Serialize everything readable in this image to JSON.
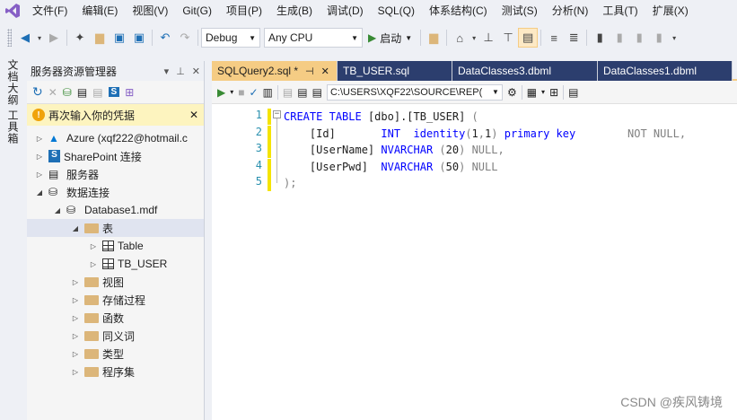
{
  "menubar": {
    "items": [
      "文件(F)",
      "编辑(E)",
      "视图(V)",
      "Git(G)",
      "项目(P)",
      "生成(B)",
      "调试(D)",
      "SQL(Q)",
      "体系结构(C)",
      "测试(S)",
      "分析(N)",
      "工具(T)",
      "扩展(X)"
    ]
  },
  "toolbar": {
    "config": "Debug",
    "platform": "Any CPU",
    "run_label": "启动"
  },
  "left_strip": {
    "tabs": [
      "文档大纲",
      "工具箱"
    ]
  },
  "explorer": {
    "title": "服务器资源管理器",
    "warning": "再次输入你的凭据",
    "tree": [
      {
        "label": "Azure (xqf222@hotmail.c",
        "icon": "azure-icon",
        "level": 0,
        "expanded": false
      },
      {
        "label": "SharePoint 连接",
        "icon": "sharepoint-icon",
        "level": 0,
        "expanded": false
      },
      {
        "label": "服务器",
        "icon": "server-icon",
        "level": 0,
        "expanded": false
      },
      {
        "label": "数据连接",
        "icon": "data-connections-icon",
        "level": 0,
        "expanded": true
      },
      {
        "label": "Database1.mdf",
        "icon": "database-icon",
        "level": 1,
        "expanded": true
      },
      {
        "label": "表",
        "icon": "folder-icon",
        "level": 2,
        "expanded": true,
        "selected": true
      },
      {
        "label": "Table",
        "icon": "table-icon",
        "level": 3,
        "expanded": false
      },
      {
        "label": "TB_USER",
        "icon": "table-icon",
        "level": 3,
        "expanded": false
      },
      {
        "label": "视图",
        "icon": "folder-icon",
        "level": 2,
        "expanded": false
      },
      {
        "label": "存储过程",
        "icon": "folder-icon",
        "level": 2,
        "expanded": false
      },
      {
        "label": "函数",
        "icon": "folder-icon",
        "level": 2,
        "expanded": false
      },
      {
        "label": "同义词",
        "icon": "folder-icon",
        "level": 2,
        "expanded": false
      },
      {
        "label": "类型",
        "icon": "folder-icon",
        "level": 2,
        "expanded": false
      },
      {
        "label": "程序集",
        "icon": "folder-icon",
        "level": 2,
        "expanded": false
      }
    ]
  },
  "editor": {
    "tabs": [
      {
        "label": "SQLQuery2.sql *",
        "active": true
      },
      {
        "label": "TB_USER.sql",
        "active": false
      },
      {
        "label": "DataClasses3.dbml",
        "active": false
      },
      {
        "label": "DataClasses1.dbml",
        "active": false
      }
    ],
    "connection": "C:\\USERS\\XQF22\\SOURCE\\REP(",
    "line_numbers": [
      "1",
      "2",
      "3",
      "4",
      "5"
    ],
    "lines": [
      "CREATE TABLE [dbo].[TB_USER] (",
      "    [Id]       INT  identity(1,1) primary key        NOT NULL,",
      "    [UserName] NVARCHAR (20) NULL,",
      "    [UserPwd]  NVARCHAR (50) NULL",
      ");"
    ]
  },
  "watermark": "CSDN @疾风铸境"
}
